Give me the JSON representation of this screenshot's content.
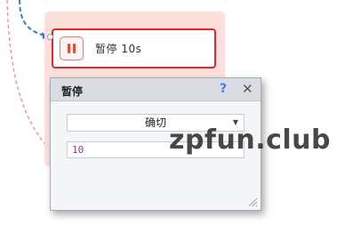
{
  "workflow": {
    "node": {
      "label": "暂停 10s",
      "icon": "pause-icon",
      "accent_color": "#e0272b",
      "group_color": "#fde0dc"
    },
    "connector_colors": {
      "incoming": "#3a7bd5",
      "branch": "#f08aa0"
    }
  },
  "dialog": {
    "title": "暂停",
    "help_icon": "question-icon",
    "close_icon": "close-icon",
    "mode_select": {
      "value": "确切",
      "icon": "caret-down-icon"
    },
    "duration_input": {
      "value": "10"
    }
  },
  "watermark": {
    "text": "zpfun.club"
  }
}
